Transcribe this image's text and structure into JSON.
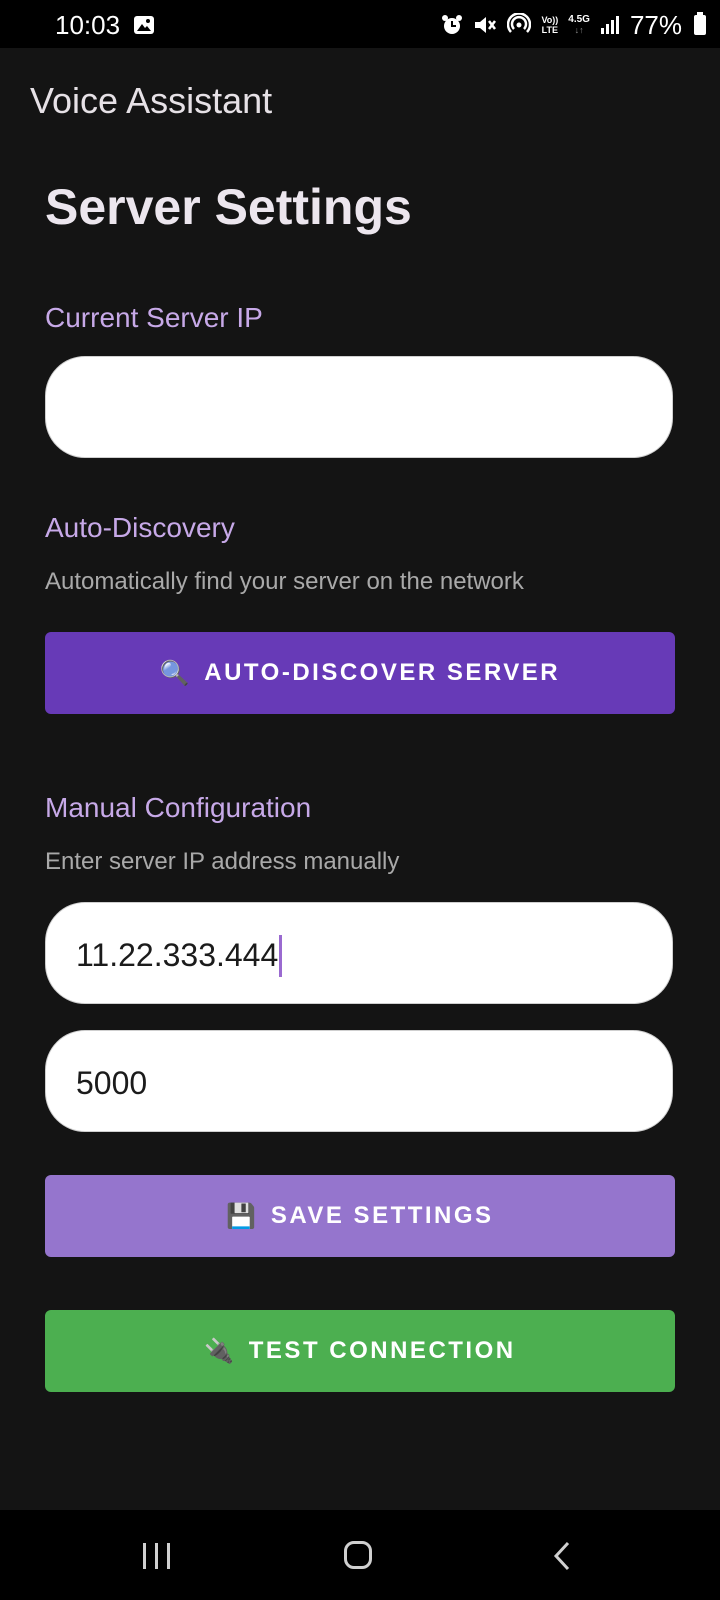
{
  "status_bar": {
    "time": "10:03",
    "network_top": "Vo))",
    "network_bottom": "LTE",
    "generation": "4.5G",
    "battery": "77%"
  },
  "app_bar": {
    "title": "Voice Assistant"
  },
  "page": {
    "title": "Server Settings"
  },
  "current_server": {
    "label": "Current Server IP",
    "value": ""
  },
  "auto_discovery": {
    "label": "Auto-Discovery",
    "description": "Automatically find your server on the network",
    "button_icon": "🔍",
    "button_label": "AUTO-DISCOVER SERVER"
  },
  "manual": {
    "label": "Manual Configuration",
    "description": "Enter server IP address manually",
    "ip_value": "11.22.333.444",
    "port_value": "5000"
  },
  "actions": {
    "save_icon": "💾",
    "save_label": "SAVE SETTINGS",
    "test_icon": "🔌",
    "test_label": "TEST CONNECTION"
  },
  "colors": {
    "accent_purple": "#673ab7",
    "save_purple": "#9575cd",
    "test_green": "#4caf50",
    "label_lavender": "#c7a9e8"
  },
  "icons": {
    "status_left": [
      "image-icon"
    ],
    "status_right": [
      "alarm-icon",
      "mute-icon",
      "hotspot-icon",
      "volte-icon",
      "signal-icon",
      "battery-icon"
    ],
    "nav": [
      "recents-icon",
      "home-icon",
      "back-icon"
    ]
  }
}
